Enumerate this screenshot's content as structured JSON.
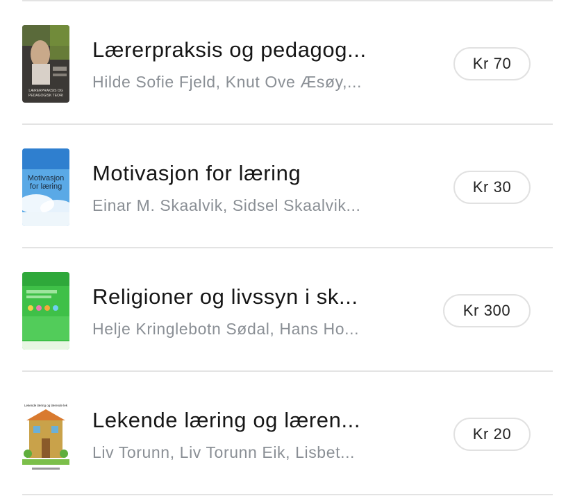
{
  "books": [
    {
      "title": "Lærerpraksis og pedagog...",
      "authors": "Hilde Sofie Fjeld, Knut Ove Æsøy,...",
      "price": "Kr 70",
      "cover_text": [
        "LÆRERPRAKSIS OG",
        "PEDAGOGISK TEORI"
      ]
    },
    {
      "title": "Motivasjon for læring",
      "authors": "Einar M. Skaalvik, Sidsel Skaalvik...",
      "price": "Kr 30",
      "cover_text": [
        "Motivasjon",
        "for læring"
      ]
    },
    {
      "title": "Religioner og livssyn i sk...",
      "authors": "Helje Kringlebotn Sødal, Hans Ho...",
      "price": "Kr 300",
      "cover_text": []
    },
    {
      "title": "Lekende læring og læren...",
      "authors": "Liv Torunn, Liv Torunn Eik, Lisbet...",
      "price": "Kr 20",
      "cover_text": [
        "Lekende læring og lærende lek"
      ]
    }
  ],
  "colors": {
    "divider": "#e3e3e3",
    "title": "#161616",
    "authors": "#8a8f95",
    "price_border": "#e1e1e1"
  }
}
